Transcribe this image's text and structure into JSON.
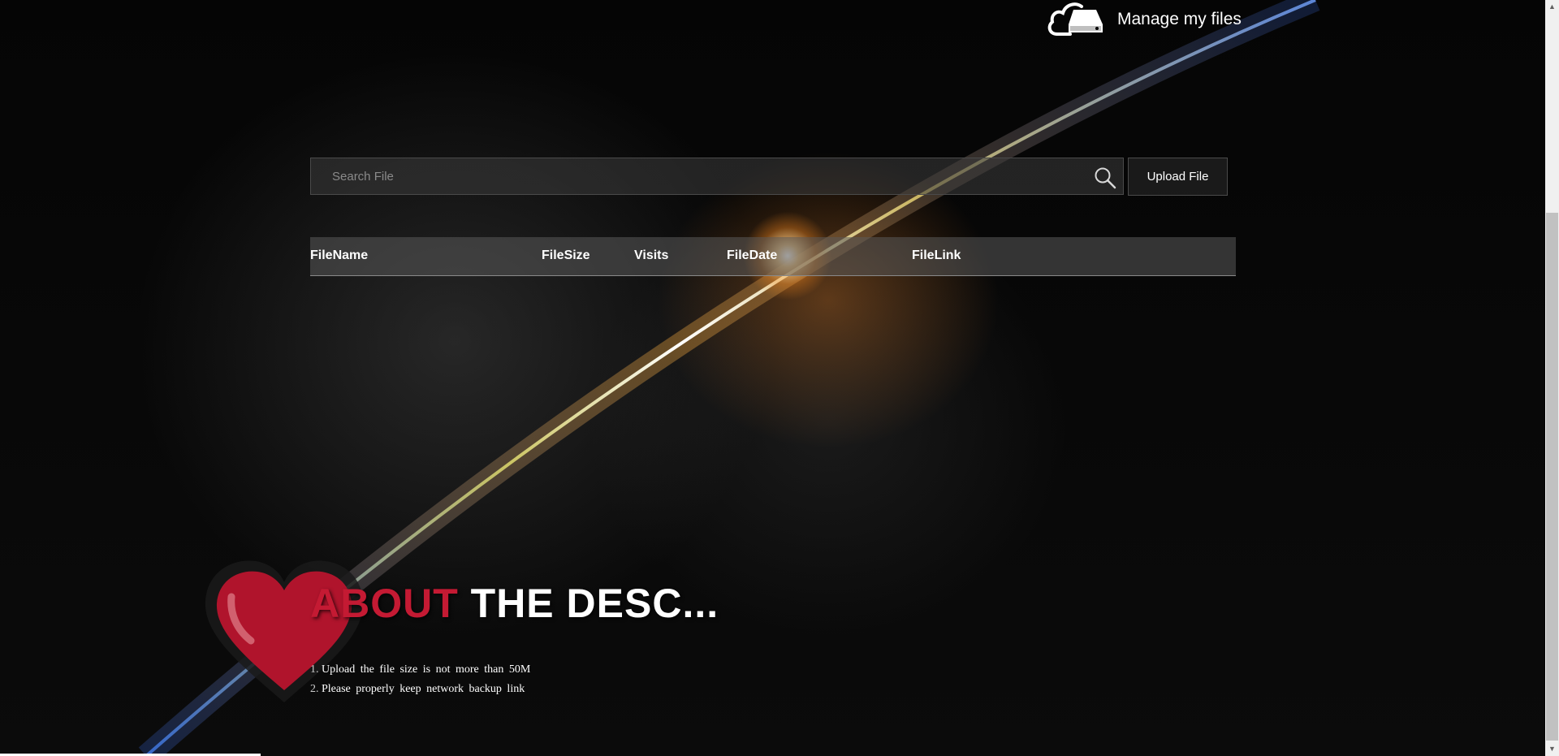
{
  "header": {
    "manage_label": "Manage my files",
    "icon": "cloud-drive-icon"
  },
  "search": {
    "placeholder": "Search File",
    "value": "",
    "icon": "search-icon"
  },
  "upload": {
    "label": "Upload File"
  },
  "table": {
    "columns": [
      "FileName",
      "FileSize",
      "Visits",
      "FileDate",
      "FileLink"
    ],
    "rows": []
  },
  "about": {
    "title_red": "ABOUT",
    "title_white": " THE DESC...",
    "icon": "heart-icon",
    "notes": [
      {
        "num": "1.",
        "text": "Upload the file size is not more than 50M"
      },
      {
        "num": "2.",
        "text": "Please properly keep network backup link"
      }
    ]
  },
  "colors": {
    "accent_red": "#c41a33",
    "background": "#000000"
  }
}
